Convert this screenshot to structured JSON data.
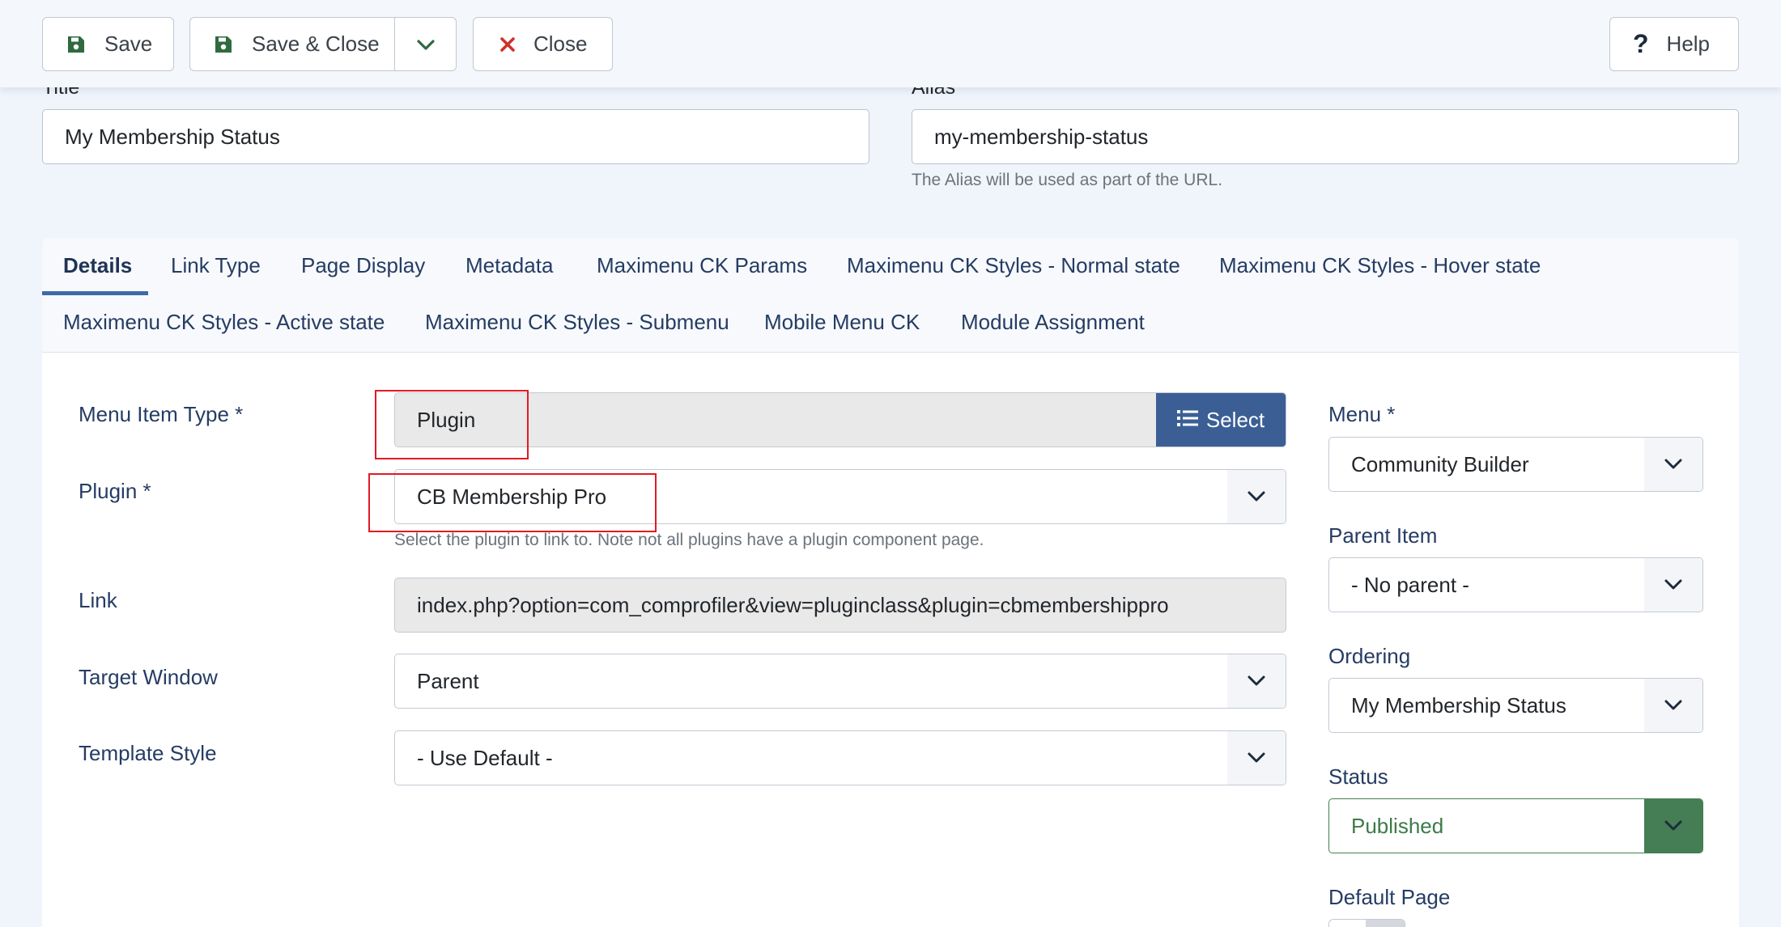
{
  "toolbar": {
    "save": "Save",
    "save_close": "Save & Close",
    "close": "Close",
    "help": "Help"
  },
  "fields": {
    "title": {
      "label": "Title",
      "value": "My Membership Status"
    },
    "alias": {
      "label": "Alias",
      "value": "my-membership-status",
      "hint": "The Alias will be used as part of the URL."
    }
  },
  "tabs": [
    "Details",
    "Link Type",
    "Page Display",
    "Metadata",
    "Maximenu CK Params",
    "Maximenu CK Styles - Normal state",
    "Maximenu CK Styles - Hover state",
    "Maximenu CK Styles - Active state",
    "Maximenu CK Styles - Submenu",
    "Mobile Menu CK",
    "Module Assignment"
  ],
  "details": {
    "menu_item_type": {
      "label": "Menu Item Type *",
      "value": "Plugin",
      "button": "Select"
    },
    "plugin": {
      "label": "Plugin *",
      "value": "CB Membership Pro",
      "hint": "Select the plugin to link to. Note not all plugins have a plugin component page."
    },
    "link": {
      "label": "Link",
      "value": "index.php?option=com_comprofiler&view=pluginclass&plugin=cbmembershippro"
    },
    "target_window": {
      "label": "Target Window",
      "value": "Parent"
    },
    "template_style": {
      "label": "Template Style",
      "value": "- Use Default -"
    }
  },
  "sidebar": {
    "menu": {
      "label": "Menu *",
      "value": "Community Builder"
    },
    "parent_item": {
      "label": "Parent Item",
      "value": "- No parent -"
    },
    "ordering": {
      "label": "Ordering",
      "value": "My Membership Status"
    },
    "status": {
      "label": "Status",
      "value": "Published"
    },
    "default_page": {
      "label": "Default Page"
    }
  },
  "colors": {
    "accent": "#3b5f95",
    "published": "#457d54",
    "highlight": "#e01b24"
  }
}
